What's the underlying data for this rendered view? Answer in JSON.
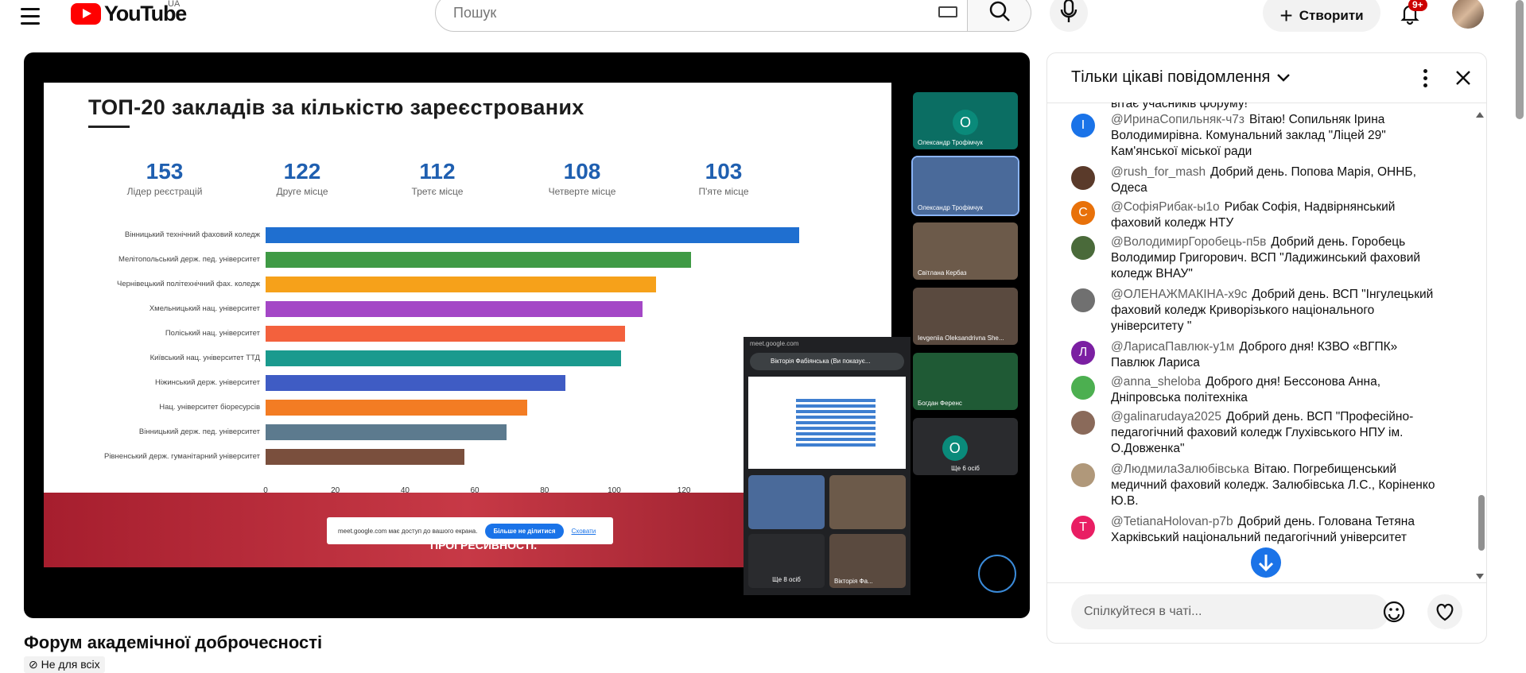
{
  "header": {
    "logo_text": "YouTube",
    "region": "UA",
    "search_placeholder": "Пошук",
    "create_label": "Створити",
    "notifications_count": "9+"
  },
  "slide": {
    "title": "ТОП-20 закладів за кількістю зареєстрованих",
    "stats": [
      {
        "value": "153",
        "label": "Лідер реєстрацій"
      },
      {
        "value": "122",
        "label": "Друге місце"
      },
      {
        "value": "112",
        "label": "Третє місце"
      },
      {
        "value": "108",
        "label": "Четверте місце"
      },
      {
        "value": "103",
        "label": "П'яте місце"
      }
    ],
    "share_notice": "meet.google.com має доступ до вашого екрана.",
    "share_stop": "Більше не ділитися",
    "share_hide": "Сховати",
    "banner_text": "ПРОГРЕСИВНОСТІ."
  },
  "chart_data": {
    "type": "bar",
    "orientation": "horizontal",
    "categories": [
      "Вінницький технічний фаховий коледж",
      "Мелітопольський держ. пед. університет",
      "Чернівецький політехнічний фах. коледж",
      "Хмельницький нац. університет",
      "Поліський нац. університет",
      "Київський нац. університет ТТД",
      "Ніжинський держ. університет",
      "Нац. університет біоресурсів",
      "Вінницький держ. пед. університет",
      "Рівненський держ. гуманітарний університет"
    ],
    "values": [
      153,
      122,
      112,
      108,
      103,
      102,
      86,
      75,
      69,
      57
    ],
    "colors": [
      "#1f6fd0",
      "#3f9a45",
      "#f6a11a",
      "#a447c6",
      "#f3613d",
      "#1a9a8e",
      "#3f5cc4",
      "#f37c23",
      "#5c7a8e",
      "#7a4f3d"
    ],
    "x_ticks": [
      "0",
      "20",
      "40",
      "60",
      "80",
      "100",
      "120"
    ],
    "xlim": [
      0,
      160
    ],
    "grid": false
  },
  "participants": {
    "tiles": [
      {
        "name": "Олександр Трофімчук",
        "initial": "О",
        "color": "#0b6e63"
      },
      {
        "name": "Олександр Трофімчук",
        "initial": "",
        "color": "#4a6a9a"
      },
      {
        "name": "Світлана Кербаз",
        "initial": "",
        "color": "#6c5a4a"
      },
      {
        "name": "Ievgeniia Oleksandrivna She...",
        "initial": "",
        "color": "#5a4a3f"
      },
      {
        "name": "Богдан Ференс",
        "initial": "",
        "color": "#1f5a35"
      },
      {
        "name": "Ще 6 осіб",
        "initial": "О",
        "color": "#2a2b2e"
      }
    ],
    "pip_title": "meet.google.com",
    "pip_presenter": "Вікторія Фабіянська (Ви показує...",
    "pip_more": "Ще 8 осіб",
    "pip_self": "Вікторія Фа..."
  },
  "video": {
    "title": "Форум академічної доброчесності",
    "visibility": "Не для всіх"
  },
  "chat": {
    "mode_label": "Тільки цікаві повідомлення",
    "partial_top": "вітає учасників форуму!",
    "messages": [
      {
        "author": "@ИринаСопильняк-ч7з",
        "text": "Вітаю! Сопильняк Ірина Володимирівна. Комунальний заклад \"Ліцей 29\" Кам'янської міської ради",
        "initial": "І",
        "color": "#1a73e8"
      },
      {
        "author": "@rush_for_mash",
        "text": "Добрий день. Попова Марія, ОННБ, Одеса",
        "initial": "",
        "color": "#5a3a2a"
      },
      {
        "author": "@СофіяРибак-ы1о",
        "text": "Рибак Софія, Надвірнянський фаховий коледж НТУ",
        "initial": "С",
        "color": "#e8710a"
      },
      {
        "author": "@ВолодимирГоробець-п5в",
        "text": "Добрий день. Горобець Володимир Григорович. ВСП \"Ладижинський фаховий коледж ВНАУ\"",
        "initial": "",
        "color": "#4a6a3a"
      },
      {
        "author": "@ОЛЕНАЖМАКІНА-х9с",
        "text": "Добрий день. ВСП \"Інгулецький фаховий коледж Криворізького національного університету \"",
        "initial": "",
        "color": "#707070"
      },
      {
        "author": "@ЛарисаПавлюк-у1м",
        "text": "Доброго дня! КЗВО «ВГПК» Павлюк Лариса",
        "initial": "Л",
        "color": "#7b1fa2"
      },
      {
        "author": "@anna_sheloba",
        "text": "Доброго дня! Бессонова Анна, Дніпровська політехніка",
        "initial": "",
        "color": "#4caf50"
      },
      {
        "author": "@galinarudaya2025",
        "text": "Добрий день. ВСП \"Професійно-педагогічний фаховий коледж Глухівського НПУ ім. О.Довженка\"",
        "initial": "",
        "color": "#8a6a5a"
      },
      {
        "author": "@ЛюдмилаЗалюбівська",
        "text": "Вітаю. Погребищенський медичний фаховий коледж. Залюбівська Л.С., Коріненко Ю.В.",
        "initial": "",
        "color": "#b0987a"
      },
      {
        "author": "@TetianaHolovan-p7b",
        "text": "Добрий день. Голована Тетяна Харківський національний педагогічний університет",
        "initial": "T",
        "color": "#e91e63"
      }
    ],
    "input_placeholder": "Спілкуйтеся в чаті..."
  }
}
